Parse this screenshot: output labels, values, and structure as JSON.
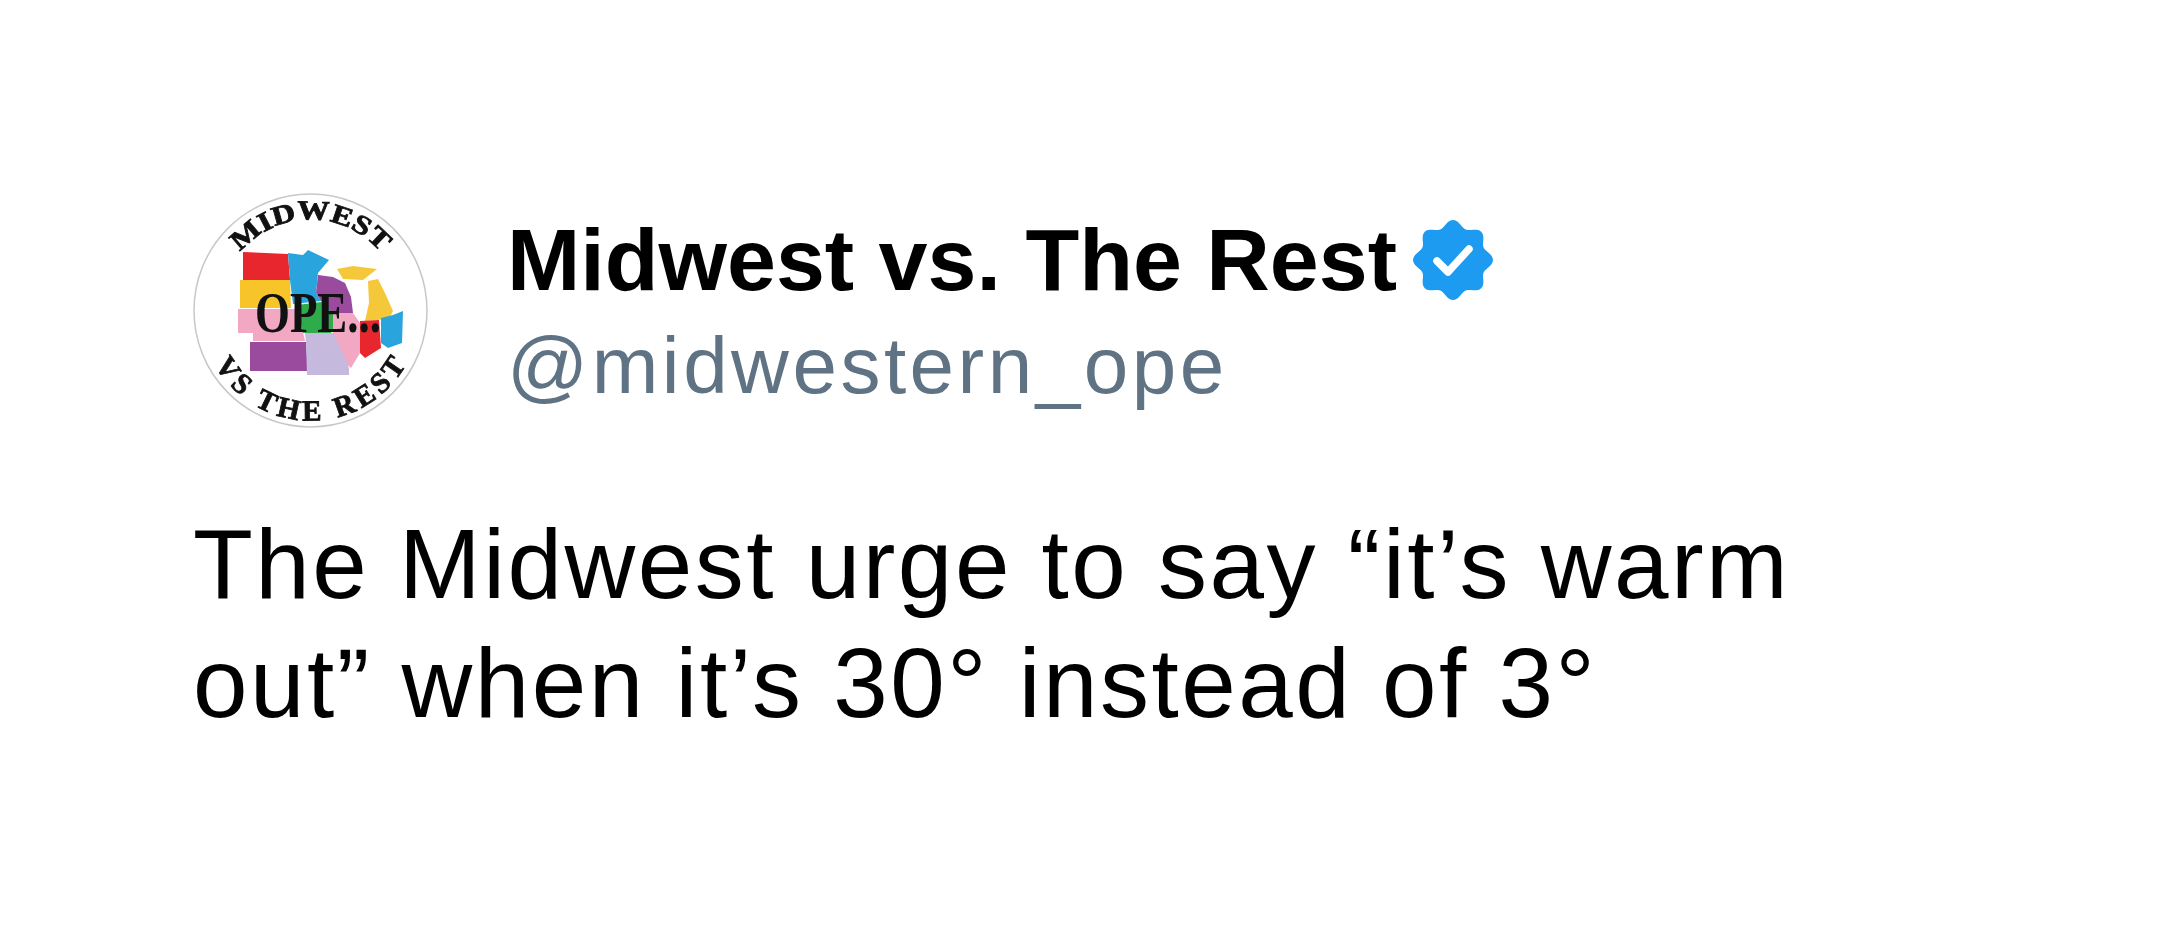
{
  "tweet": {
    "avatar": {
      "top_text": "MIDWEST",
      "center_text": "OPE...",
      "bottom_text": "VS THE REST"
    },
    "name": "Midwest vs. The Rest",
    "verified": true,
    "handle": "@midwestern_ope",
    "text": "The Midwest urge to say “it’s warm out” when it’s 30° instead of 3°"
  }
}
